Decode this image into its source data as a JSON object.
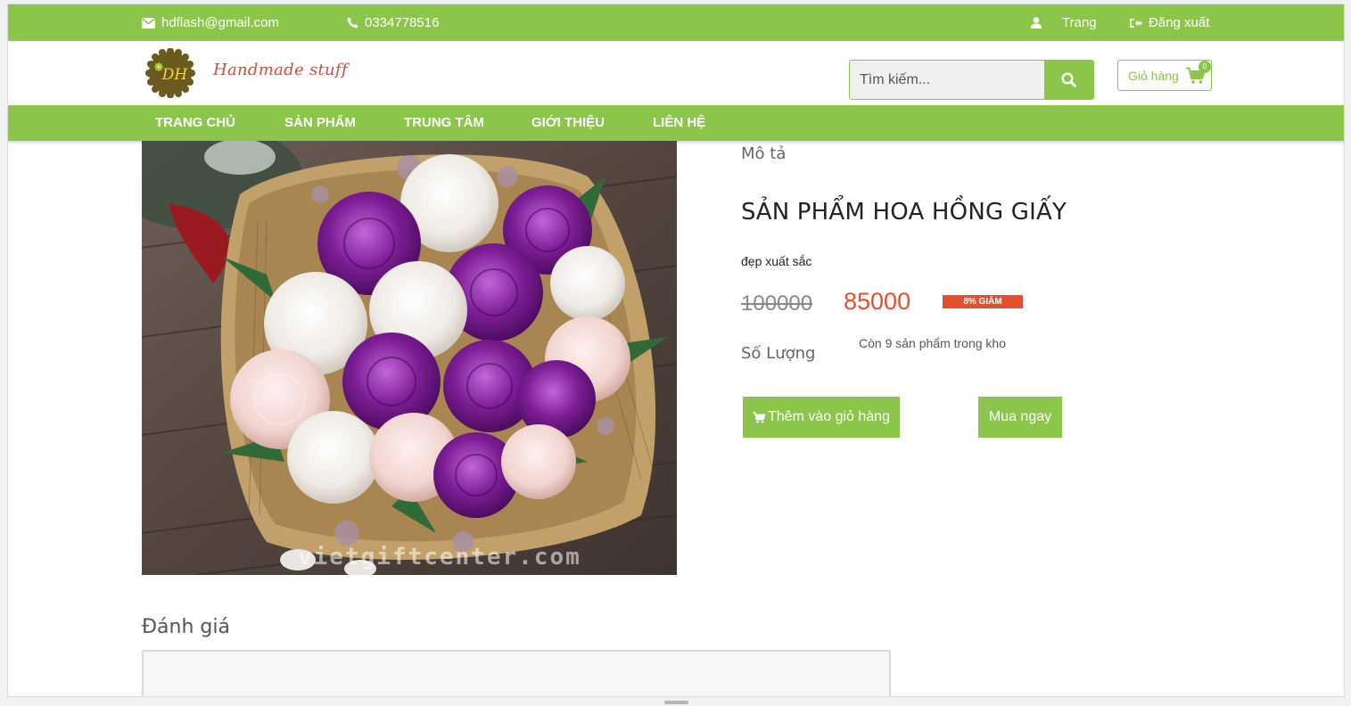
{
  "topbar": {
    "email": "hdflash@gmail.com",
    "phone": "0334778516",
    "account_label": "Trang",
    "logout_label": "Đăng xuất"
  },
  "header": {
    "logo_badge_text": "DH",
    "logo_text": "Handmade stuff",
    "search_placeholder": "Tìm kiếm...",
    "cart_label": "Giỏ hàng",
    "cart_count": "0"
  },
  "nav": {
    "items": [
      {
        "label": "TRANG CHỦ"
      },
      {
        "label": "SẢN PHẨM"
      },
      {
        "label": "TRUNG TÂM"
      },
      {
        "label": "GIỚI THIỆU"
      },
      {
        "label": "LIÊN HỆ"
      }
    ]
  },
  "product": {
    "image_watermark": "vietgiftcenter.com",
    "description_label": "Mô tả",
    "title": "SẢN PHẨM HOA HỒNG GIẤY",
    "subtitle": "đẹp xuất sắc",
    "old_price": "100000",
    "new_price": "85000",
    "discount": "8% GIẢM",
    "quantity_label": "Số Lượng",
    "stock_text": "Còn 9 sản phẩm trong kho",
    "add_to_cart_label": "Thêm vào giỏ hàng",
    "buy_now_label": "Mua ngay"
  },
  "review": {
    "heading": "Đánh giá"
  },
  "colors": {
    "brand_green": "#8bc54a",
    "price_red": "#e3502b"
  }
}
